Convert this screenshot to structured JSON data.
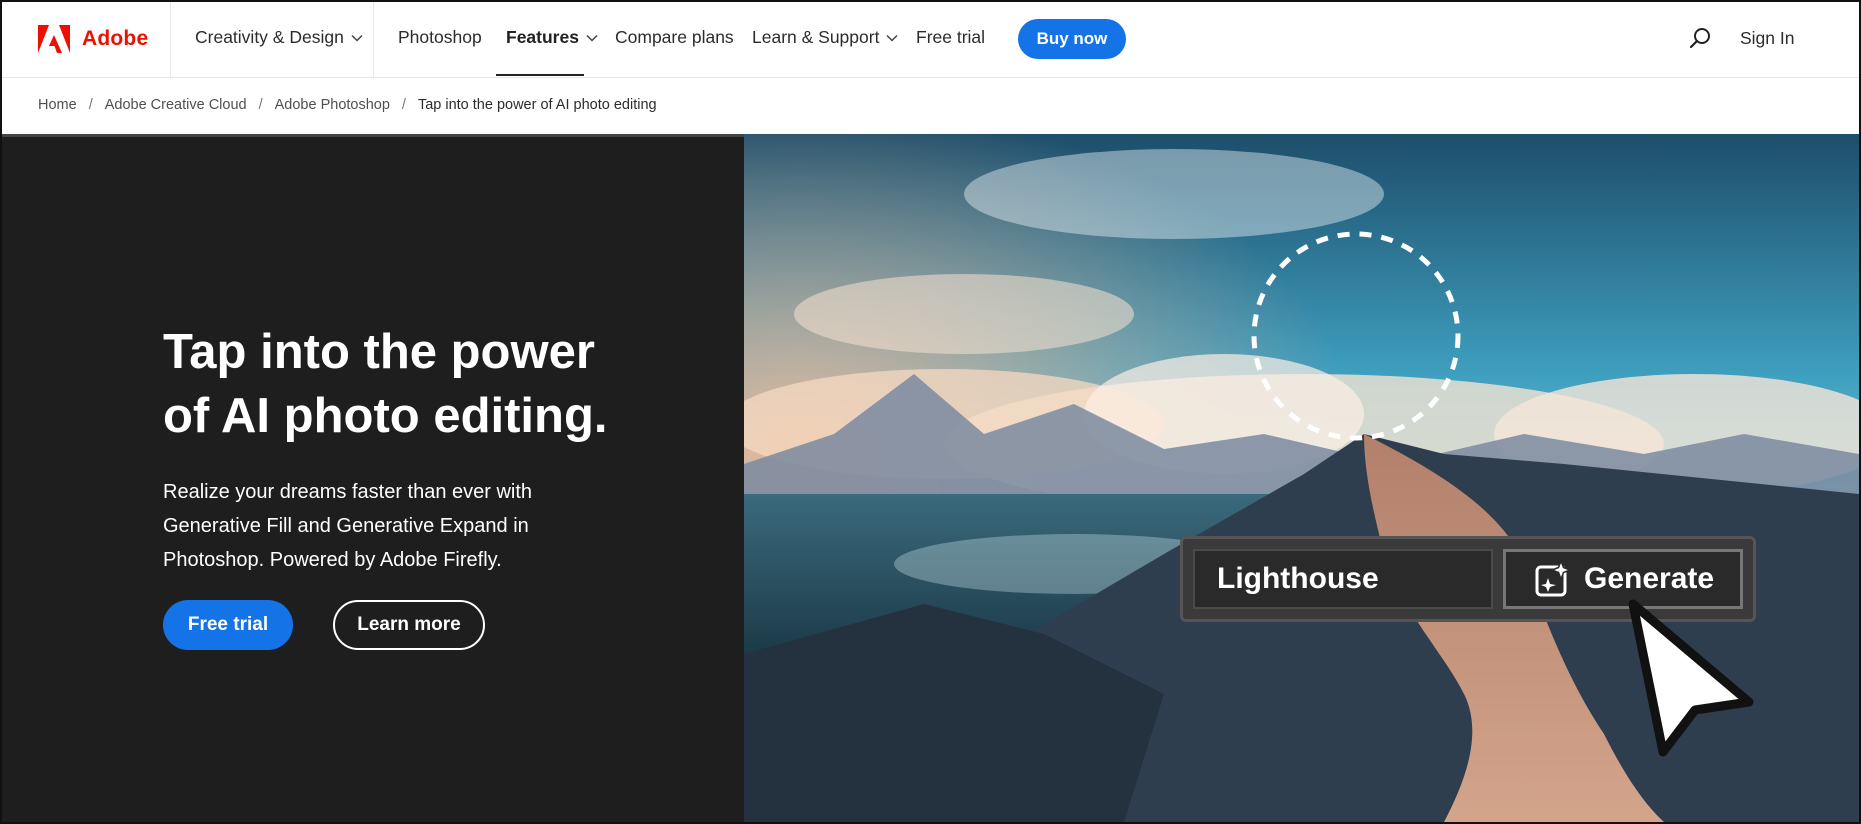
{
  "nav": {
    "brand": "Adobe",
    "items": [
      {
        "label": "Creativity & Design",
        "dropdown": true
      },
      {
        "label": "Photoshop",
        "dropdown": false
      },
      {
        "label": "Features",
        "dropdown": true,
        "active": true
      },
      {
        "label": "Compare plans",
        "dropdown": false
      },
      {
        "label": "Learn & Support",
        "dropdown": true
      },
      {
        "label": "Free trial",
        "dropdown": false
      }
    ],
    "buy_now": "Buy now",
    "sign_in": "Sign In"
  },
  "breadcrumb": {
    "items": [
      "Home",
      "Adobe Creative Cloud",
      "Adobe Photoshop",
      "Tap into the power of AI photo editing"
    ],
    "separator": "/"
  },
  "hero": {
    "title_line1": "Tap into the power",
    "title_line2": "of AI photo editing.",
    "description": "Realize your dreams faster than ever with Generative Fill and Generative Expand in Photoshop. Powered by Adobe Firefly.",
    "cta_primary": "Free trial",
    "cta_secondary": "Learn more"
  },
  "generate_ui": {
    "prompt_value": "Lighthouse",
    "button_label": "Generate"
  },
  "colors": {
    "brand_red": "#eb1000",
    "accent_blue": "#1473e6",
    "hero_dark": "#1e1e1e"
  },
  "icons": [
    "adobe-logo-icon",
    "chevron-down-icon",
    "search-icon",
    "generative-fill-icon",
    "pointer-cursor-icon"
  ]
}
